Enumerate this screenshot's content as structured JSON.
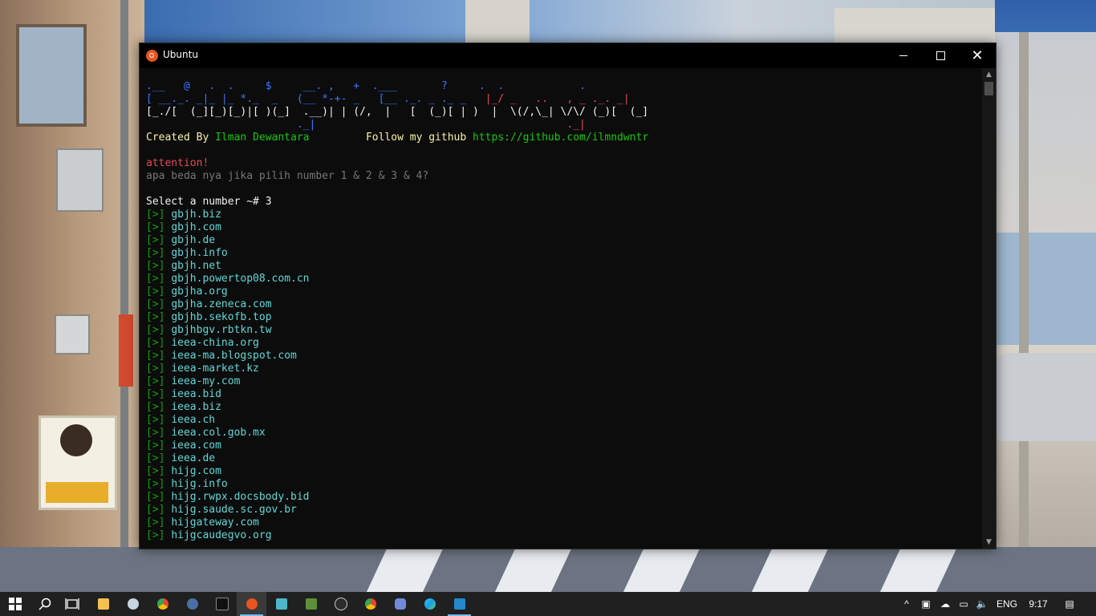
{
  "window": {
    "title": "Ubuntu",
    "minimize_symbol": "",
    "close_symbol": "✕"
  },
  "banner": {
    "line1": ".__   @   .  .     $     __. ,   +  .___       ?     .  .            .",
    "line2": "[ __._. _|_ |_ *._  _   (__ *-+- _   [__ ._. _ ._ _   |_/ _   ..   , _ ._. _|",
    "line3": "[_./[  (_][_)[_)|[ )(_]  .__)| | (/,  |   [  (_)[ | )  |  \\(/,\\_| \\/\\/ (_)[  (_]",
    "line4a": "                        ._|",
    "line4b": "                                        ._|"
  },
  "credits": {
    "created_label": "Created By ",
    "author": "Ilman Dewantara",
    "follow_label": "Follow my github ",
    "github_url": "https://github.com/ilmndwntr"
  },
  "notice": {
    "title": "attention!",
    "question": "apa beda nya jika pilih number 1 & 2 & 3 & 4?"
  },
  "prompt": {
    "text": "Select a number ~# 3"
  },
  "result_prefix": "[>]",
  "results": [
    "gbjh.biz",
    "gbjh.com",
    "gbjh.de",
    "gbjh.info",
    "gbjh.net",
    "gbjh.powertop08.com.cn",
    "gbjha.org",
    "gbjha.zeneca.com",
    "gbjhb.sekofb.top",
    "gbjhbgv.rbtkn.tw",
    "ieea-china.org",
    "ieea-ma.blogspot.com",
    "ieea-market.kz",
    "ieea-my.com",
    "ieea.bid",
    "ieea.biz",
    "ieea.ch",
    "ieea.col.gob.mx",
    "ieea.com",
    "ieea.de",
    "hijg.com",
    "hijg.info",
    "hijg.rwpx.docsbody.bid",
    "hijg.saude.sc.gov.br",
    "hijgateway.com",
    "hijgcaudegvo.org"
  ],
  "colors": {
    "terminal_bg": "#0c0c0c",
    "banner_blue": "#3b78ff",
    "banner_red": "#e74856",
    "label_yellow": "#f9f1a5",
    "link_green": "#16c60c",
    "result_cyan": "#61d6d6",
    "taskbar_bg": "#202020"
  },
  "taskbar": {
    "apps": [
      {
        "name": "start",
        "icon": "windows-logo-icon"
      },
      {
        "name": "search",
        "icon": "search-icon"
      },
      {
        "name": "task-view",
        "icon": "task-view-icon"
      },
      {
        "name": "file-explorer",
        "icon": "folder-icon"
      },
      {
        "name": "steam",
        "icon": "steam-icon"
      },
      {
        "name": "chrome",
        "icon": "chrome-icon"
      },
      {
        "name": "game-app",
        "icon": "game-icon"
      },
      {
        "name": "terminal",
        "icon": "terminal-icon"
      },
      {
        "name": "ubuntu",
        "icon": "ubuntu-icon"
      },
      {
        "name": "sublime",
        "icon": "sublime-icon"
      },
      {
        "name": "minecraft",
        "icon": "minecraft-icon"
      },
      {
        "name": "obs",
        "icon": "obs-icon"
      },
      {
        "name": "chrome-2",
        "icon": "chrome-icon"
      },
      {
        "name": "discord",
        "icon": "discord-icon"
      },
      {
        "name": "edge",
        "icon": "edge-icon"
      },
      {
        "name": "vscode",
        "icon": "vscode-icon"
      }
    ],
    "language": "ENG",
    "time": "9:17"
  }
}
